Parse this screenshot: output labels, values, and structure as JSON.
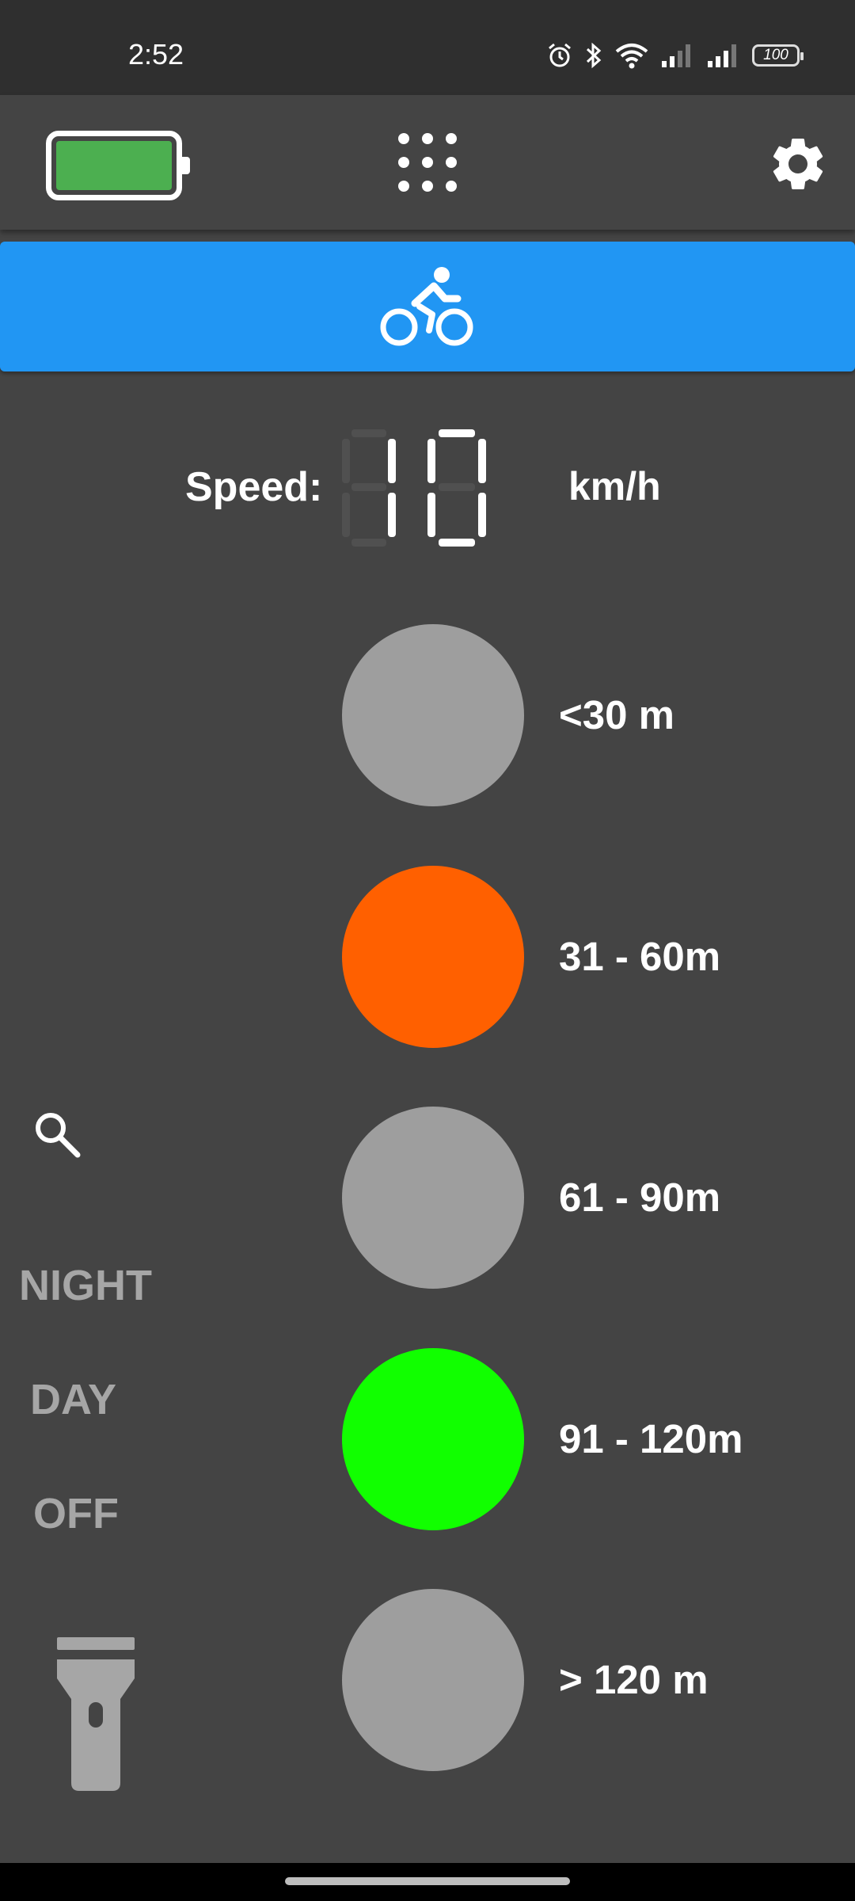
{
  "status_bar": {
    "time": "2:52",
    "battery_level": "100"
  },
  "toolbar": {
    "battery_icon": "battery-full-icon",
    "battery_color": "#4caf50",
    "menu_icon": "grid-dots-icon",
    "settings_icon": "gear-icon"
  },
  "mode_bar": {
    "icon": "bicycle-icon",
    "color": "#2196f3"
  },
  "speed": {
    "label": "Speed:",
    "value": "10",
    "unit": "km/h"
  },
  "indicators": [
    {
      "label": "<30 m",
      "color": "#9e9e9e",
      "active": false
    },
    {
      "label": "31 - 60m",
      "color": "#ff6000",
      "active": true
    },
    {
      "label": "61 - 90m",
      "color": "#9e9e9e",
      "active": false
    },
    {
      "label": "91 - 120m",
      "color": "#11ff00",
      "active": true
    },
    {
      "label": "> 120 m",
      "color": "#9e9e9e",
      "active": false
    }
  ],
  "light_modes": {
    "search_icon": "search-icon",
    "night": "NIGHT",
    "day": "DAY",
    "off": "OFF",
    "flashlight_icon": "flashlight-icon"
  }
}
